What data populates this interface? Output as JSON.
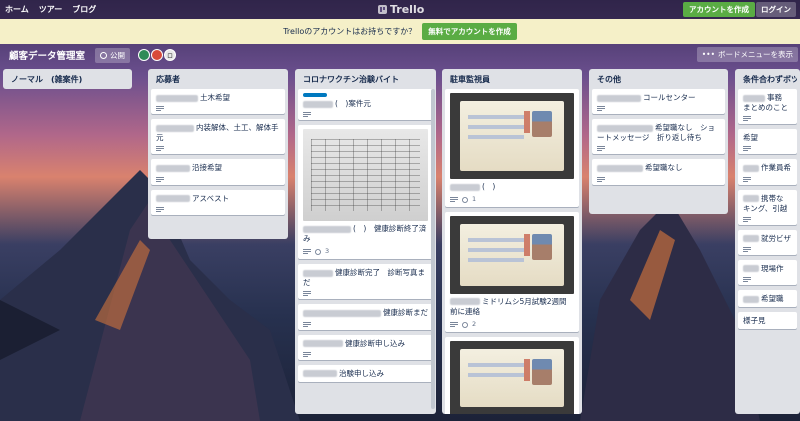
{
  "header": {
    "nav": [
      "ホーム",
      "ツアー",
      "ブログ"
    ],
    "logo_text": "Trello",
    "signup_label": "アカウントを作成",
    "login_label": "ログイン"
  },
  "banner": {
    "message": "Trelloのアカウントはお持ちですか？",
    "cta_label": "無料でアカウントを作成"
  },
  "board": {
    "title": "顧客データ管理室",
    "visibility_label": "公開",
    "member_initial": "ロ",
    "menu_label": "ボードメニューを表示"
  },
  "colors": {
    "accent_green": "#5aac44",
    "label_blue": "#0079bf"
  },
  "lists": [
    {
      "title": "ノーマル　(雑案件)",
      "cards": []
    },
    {
      "title": "応募者",
      "cards": [
        {
          "text": "土木希望"
        },
        {
          "text": "内装解体、土工、解体手元"
        },
        {
          "text": "沿接希望"
        },
        {
          "text": "アスベスト"
        }
      ]
    },
    {
      "title": "コロナワクチン治験バイト",
      "cards": [
        {
          "text": "(　)案件元"
        },
        {
          "text": "(　)　健康診断終了済み",
          "attachments": "3"
        },
        {
          "text": "健康診断完了　診断写真まだ"
        },
        {
          "text": "健康診断まだ"
        },
        {
          "text": "健康診断申し込み"
        },
        {
          "text": "治験申し込み"
        }
      ]
    },
    {
      "title": "駐車監視員",
      "cards": [
        {
          "text": "(　)",
          "attachments": "1"
        },
        {
          "text": "ミドリムシ5月試験2週間前に連絡",
          "attachments": "2"
        }
      ]
    },
    {
      "title": "その他",
      "cards": [
        {
          "text": "コールセンター"
        },
        {
          "text": "希望職なし　ショートメッセージ　折り返し待ち"
        },
        {
          "text": "希望職なし"
        }
      ]
    },
    {
      "title": "条件合わずボツ",
      "cards": [
        {
          "text": "事務　まとめのこと"
        },
        {
          "text": "希望"
        },
        {
          "text": "作業員希"
        },
        {
          "text": "携帯な　キング、引越"
        },
        {
          "text": "就労ビザ"
        },
        {
          "text": "現場作"
        },
        {
          "text": "希望職"
        },
        {
          "text": "様子見"
        }
      ]
    }
  ]
}
